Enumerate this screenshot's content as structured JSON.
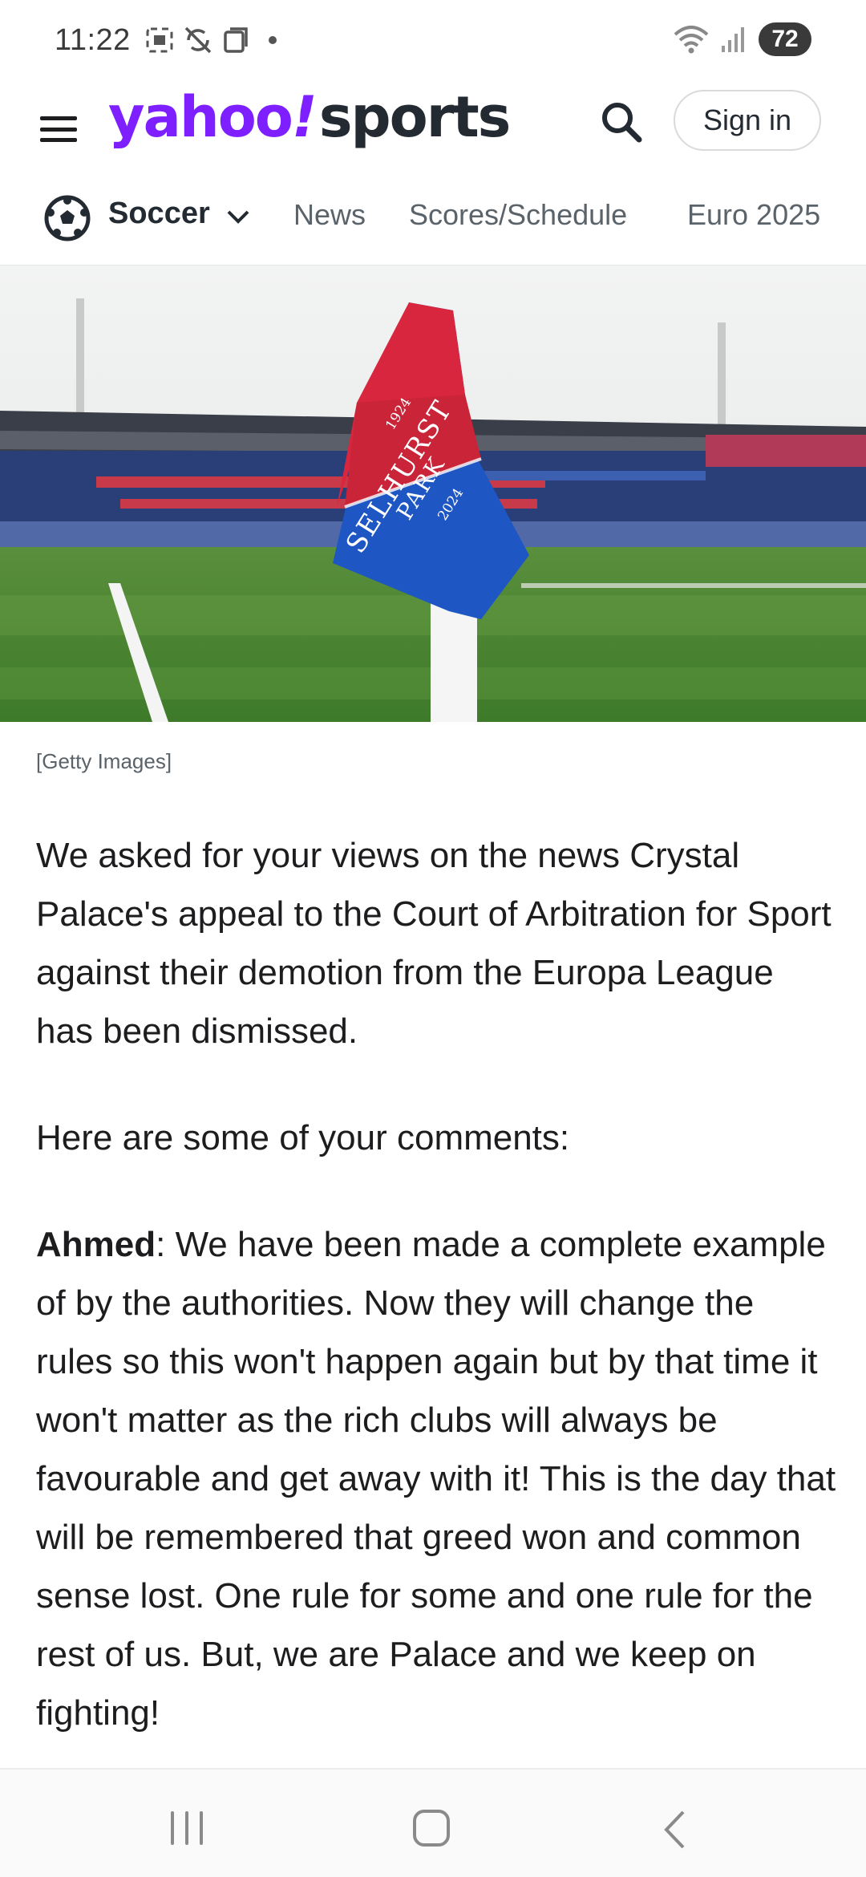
{
  "status_bar": {
    "time": "11:22",
    "battery": "72"
  },
  "header": {
    "logo_yahoo": "yahoo",
    "logo_bang": "!",
    "logo_sports": "sports",
    "signin_label": "Sign in",
    "brand_color": "#7e1fff"
  },
  "subnav": {
    "sport": "Soccer",
    "links": [
      "News",
      "Scores/Schedule",
      "Euro 2025"
    ]
  },
  "image": {
    "caption": "[Getty Images]",
    "flag_lines": [
      "1924",
      "SELHURST",
      "PARK",
      "2024"
    ]
  },
  "article": {
    "intro": "We asked for your views on the news Crystal Palace's appeal to the Court of Arbitration for Sport against their demotion from the Europa League has been dismissed.",
    "lead": "Here are some of your comments:",
    "comment_author": "Ahmed",
    "comment_text": ": We have been made a complete example of by the authorities. Now they will change the rules so this won't happen again but by that time it won't matter as the rich clubs will always be favourable and get away with it! This is the day that will be remembered that greed won and common sense lost. One rule for some and one rule for the rest of us. But, we are Palace and we keep on fighting!"
  }
}
